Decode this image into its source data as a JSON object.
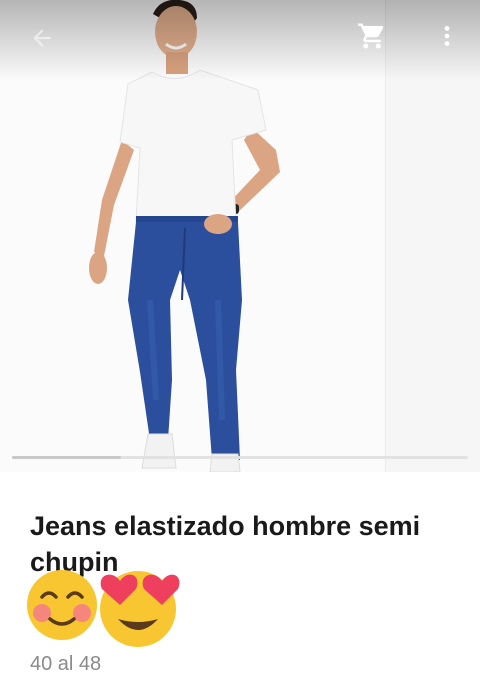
{
  "toolbar": {
    "back_icon": "arrow-back-icon",
    "cart_icon": "shopping-cart-icon",
    "menu_icon": "more-vert-icon"
  },
  "gallery": {
    "image_subject": "man-in-white-tshirt-and-blue-jeans",
    "scroll_progress": 0.24
  },
  "product": {
    "title": "Jeans elastizado hombre semi chupin",
    "emojis": [
      "smiling-face-with-blush-icon",
      "heart-eyes-face-icon"
    ],
    "size_range": "40 al 48"
  },
  "colors": {
    "denim": "#2b4f9c",
    "text": "#1a1a1a",
    "subtext": "#8a8a8a"
  }
}
